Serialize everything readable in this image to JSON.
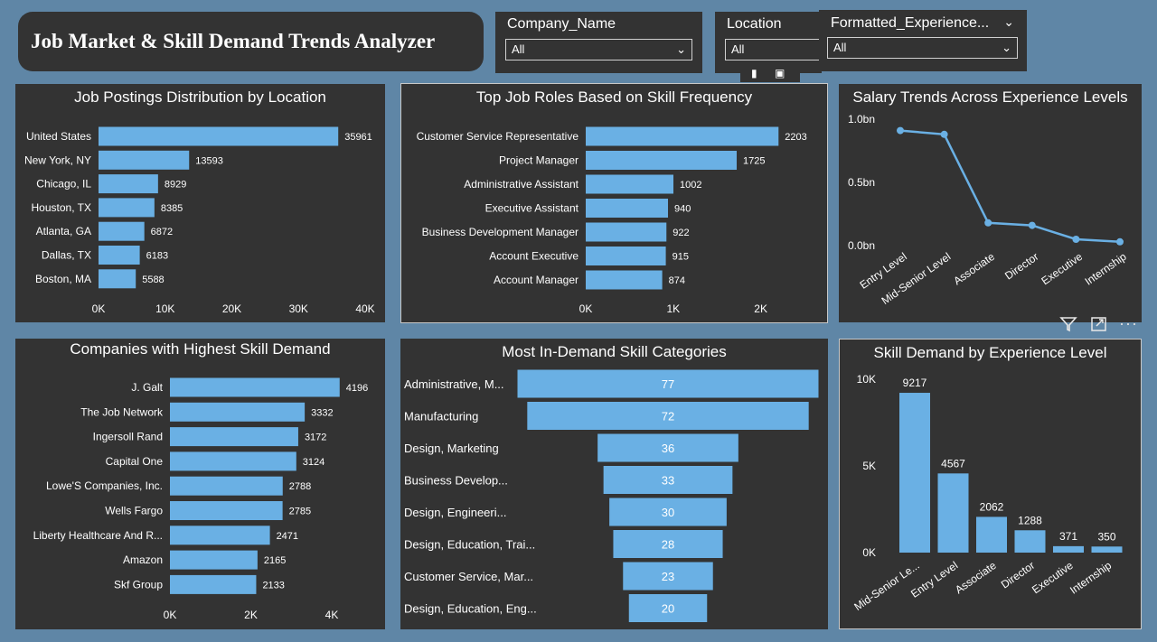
{
  "header": {
    "title": "Job Market & Skill Demand Trends Analyzer"
  },
  "slicers": {
    "company": {
      "label": "Company_Name",
      "value": "All"
    },
    "location": {
      "label": "Location",
      "value": "All"
    },
    "experience": {
      "label": "Formatted_Experience...",
      "value": "All"
    }
  },
  "icons": {
    "filter": "filter-icon",
    "focus": "focus-mode-icon",
    "more": "more-options-icon",
    "chevron": "chevron-down-icon"
  },
  "colors": {
    "bar": "#6ab0e4",
    "panel": "#333333",
    "background": "#5f86a6"
  },
  "chart_data": [
    {
      "id": "locations",
      "type": "bar",
      "orientation": "horizontal",
      "title": "Job Postings Distribution by Location",
      "categories": [
        "United States",
        "New York, NY",
        "Chicago, IL",
        "Houston, TX",
        "Atlanta, GA",
        "Dallas, TX",
        "Boston, MA"
      ],
      "values": [
        35961,
        13593,
        8929,
        8385,
        6872,
        6183,
        5588
      ],
      "xlim": [
        0,
        40000
      ],
      "ticks": [
        0,
        10000,
        20000,
        30000,
        40000
      ],
      "tick_labels": [
        "0K",
        "10K",
        "20K",
        "30K",
        "40K"
      ]
    },
    {
      "id": "roles",
      "type": "bar",
      "orientation": "horizontal",
      "title": "Top Job Roles Based on Skill Frequency",
      "categories": [
        "Customer Service Representative",
        "Project Manager",
        "Administrative Assistant",
        "Executive Assistant",
        "Business Development Manager",
        "Account Executive",
        "Account Manager"
      ],
      "values": [
        2203,
        1725,
        1002,
        940,
        922,
        915,
        874
      ],
      "xlim": [
        0,
        2200
      ],
      "ticks": [
        0,
        1000,
        2000
      ],
      "tick_labels": [
        "0K",
        "1K",
        "2K"
      ]
    },
    {
      "id": "salary",
      "type": "line",
      "title": "Salary Trends Across Experience Levels",
      "categories": [
        "Entry Level",
        "Mid-Senior Level",
        "Associate",
        "Director",
        "Executive",
        "Internship"
      ],
      "values": [
        0.91,
        0.88,
        0.18,
        0.16,
        0.05,
        0.03
      ],
      "ylim": [
        0,
        1.0
      ],
      "ticks": [
        0,
        0.5,
        1.0
      ],
      "tick_labels": [
        "0.0bn",
        "0.5bn",
        "1.0bn"
      ]
    },
    {
      "id": "companies",
      "type": "bar",
      "orientation": "horizontal",
      "title": "Companies with Highest Skill Demand",
      "categories": [
        "J. Galt",
        "The Job Network",
        "Ingersoll Rand",
        "Capital One",
        "Lowe'S Companies, Inc.",
        "Wells Fargo",
        "Liberty Healthcare And R...",
        "Amazon",
        "Skf Group"
      ],
      "values": [
        4196,
        3332,
        3172,
        3124,
        2788,
        2785,
        2471,
        2165,
        2133
      ],
      "xlim": [
        0,
        4000
      ],
      "ticks": [
        0,
        2000,
        4000
      ],
      "tick_labels": [
        "0K",
        "2K",
        "4K"
      ]
    },
    {
      "id": "categories",
      "type": "funnel",
      "title": "Most In-Demand Skill Categories",
      "categories": [
        "Administrative, M...",
        "Manufacturing",
        "Design, Marketing",
        "Business Develop...",
        "Design, Engineeri...",
        "Design, Education, Trai...",
        "Customer Service, Mar...",
        "Design, Education, Eng..."
      ],
      "values": [
        77,
        72,
        36,
        33,
        30,
        28,
        23,
        20
      ]
    },
    {
      "id": "experience",
      "type": "bar",
      "orientation": "vertical",
      "title": "Skill Demand by Experience Level",
      "categories": [
        "Mid-Senior Le...",
        "Entry Level",
        "Associate",
        "Director",
        "Executive",
        "Internship"
      ],
      "values": [
        9217,
        4567,
        2062,
        1288,
        371,
        350
      ],
      "ylim": [
        0,
        10000
      ],
      "ticks": [
        0,
        5000,
        10000
      ],
      "tick_labels": [
        "0K",
        "5K",
        "10K"
      ]
    }
  ]
}
